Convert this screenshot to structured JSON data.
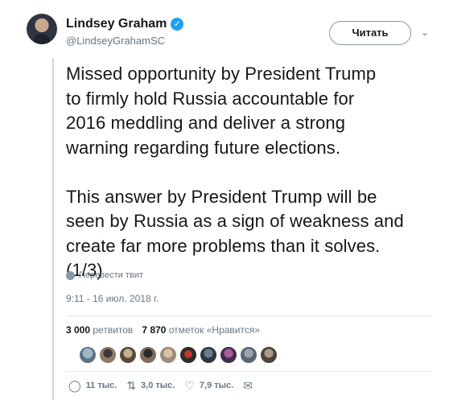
{
  "author": {
    "display_name": "Lindsey Graham",
    "handle": "@LindseyGrahamSC",
    "verified_icon": "verified-badge-icon"
  },
  "follow_button_label": "Читать",
  "tweet": {
    "paragraph1": "Missed opportunity by President Trump\nto firmly hold Russia accountable for\n2016 meddling and deliver a strong\nwarning regarding future elections.",
    "paragraph2": "This answer by President Trump will be\nseen by Russia as a sign of weakness and\ncreate far more problems than it solves.\n(1/3)"
  },
  "translate_label": "Перевести твит",
  "timestamp": "9:11 - 16 июл. 2018 г.",
  "stats": {
    "retweets_count": "3 000",
    "retweets_label": "ретвитов",
    "likes_count": "7 870",
    "likes_label": "отметок «Нравится»"
  },
  "actions": {
    "replies": "11 тыс.",
    "retweets": "3,0 тыс.",
    "likes": "7,9 тыс."
  },
  "colors": {
    "accent": "#1da1f2",
    "muted": "#657786",
    "text": "#14171a"
  }
}
